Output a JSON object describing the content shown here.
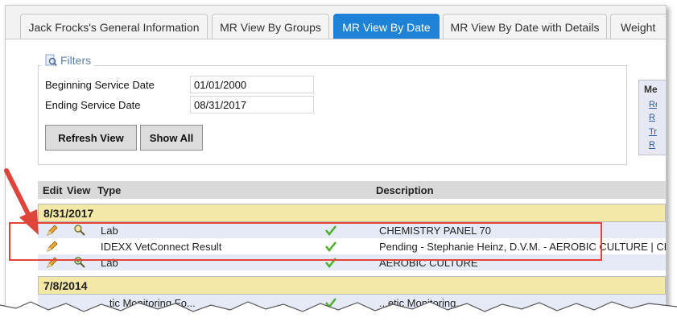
{
  "tabs": [
    {
      "label": "Jack Frocks's General Information",
      "active": false
    },
    {
      "label": "MR View By Groups",
      "active": false
    },
    {
      "label": "MR View By Date",
      "active": true
    },
    {
      "label": "MR View By Date with Details",
      "active": false
    },
    {
      "label": "Weight",
      "active": false
    }
  ],
  "filters": {
    "legend": "Filters",
    "beginning_label": "Beginning Service Date",
    "beginning_value": "01/01/2000",
    "ending_label": "Ending Service Date",
    "ending_value": "08/31/2017",
    "refresh_label": "Refresh View",
    "show_all_label": "Show All"
  },
  "side_menu": {
    "title": "Me",
    "links": [
      "Re",
      "R",
      "Tre",
      "R"
    ]
  },
  "table": {
    "headers": {
      "edit": "Edit",
      "view": "View",
      "type": "Type",
      "description": "Description"
    },
    "groups": [
      {
        "date": "8/31/2017",
        "rows": [
          {
            "type": "Lab",
            "description": "CHEMISTRY PANEL 70",
            "has_view": true
          },
          {
            "type": "IDEXX VetConnect Result",
            "description": "Pending - Stephanie Heinz, D.V.M. - AEROBIC CULTURE | CH",
            "has_view": false
          },
          {
            "type": "Lab",
            "description": "AEROBIC CULTURE",
            "has_view": true
          }
        ]
      },
      {
        "date": "7/8/2014",
        "rows": [
          {
            "type": "...tic Monitoring Fo...",
            "description": "...etic Monitoring...",
            "has_view": true
          }
        ]
      }
    ]
  },
  "colors": {
    "active_tab": "#1e83d6",
    "group_row": "#f4e8a6",
    "alt_row": "#e6eaf7",
    "highlight": "#e0453c",
    "check": "#4caf2a"
  }
}
